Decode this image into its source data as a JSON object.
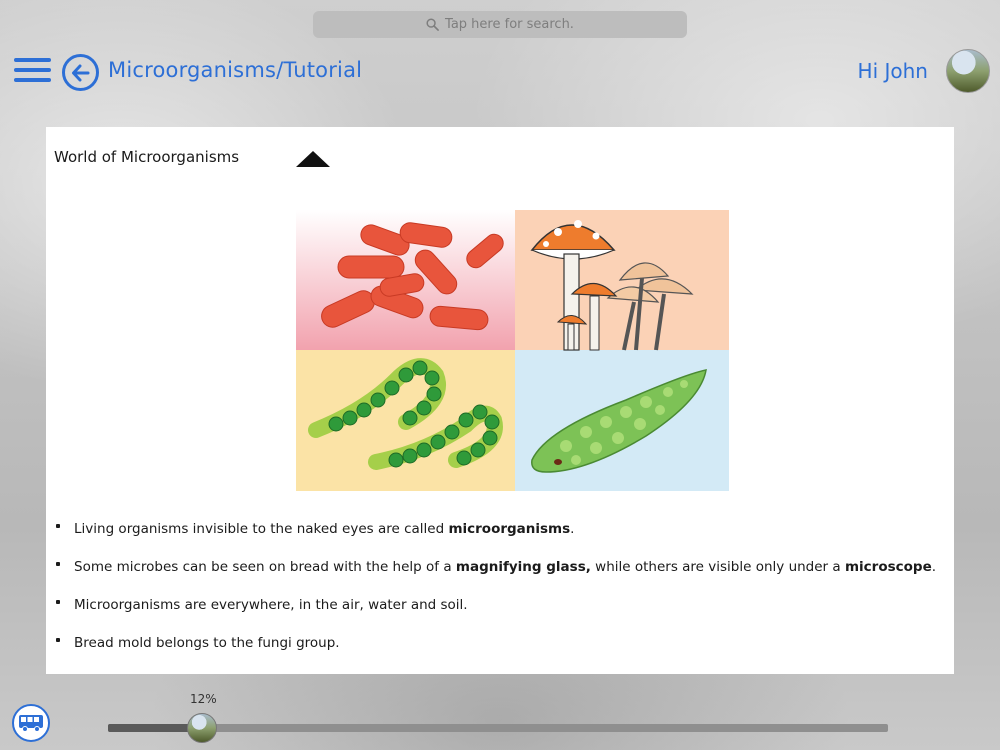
{
  "search": {
    "placeholder": "Tap here for search."
  },
  "header": {
    "title": "Microorganisms/Tutorial",
    "greeting": "Hi John"
  },
  "card": {
    "title": "World of Microorganisms",
    "bullets": [
      {
        "before": "Living organisms invisible to the naked eyes are called ",
        "bold1": "microorganisms",
        "middle": ".",
        "bold2": "",
        "after": ""
      },
      {
        "before": "Some microbes can be seen on bread with the help of a ",
        "bold1": "magnifying glass,",
        "middle": " while others are visible only under a ",
        "bold2": "microscope",
        "after": "."
      },
      {
        "before": "Microorganisms are everywhere, in the air, water and soil.",
        "bold1": "",
        "middle": "",
        "bold2": "",
        "after": ""
      },
      {
        "before": "Bread mold belongs to the fungi group.",
        "bold1": "",
        "middle": "",
        "bold2": "",
        "after": ""
      }
    ]
  },
  "progress": {
    "label": "12%",
    "value": 0.12
  },
  "icons": {
    "menu": "hamburger-menu-icon",
    "back": "back-arrow-icon",
    "search": "search-icon",
    "collapse": "collapse-triangle-icon",
    "bus": "bus-icon"
  },
  "colors": {
    "accent": "#2d6fd6"
  }
}
